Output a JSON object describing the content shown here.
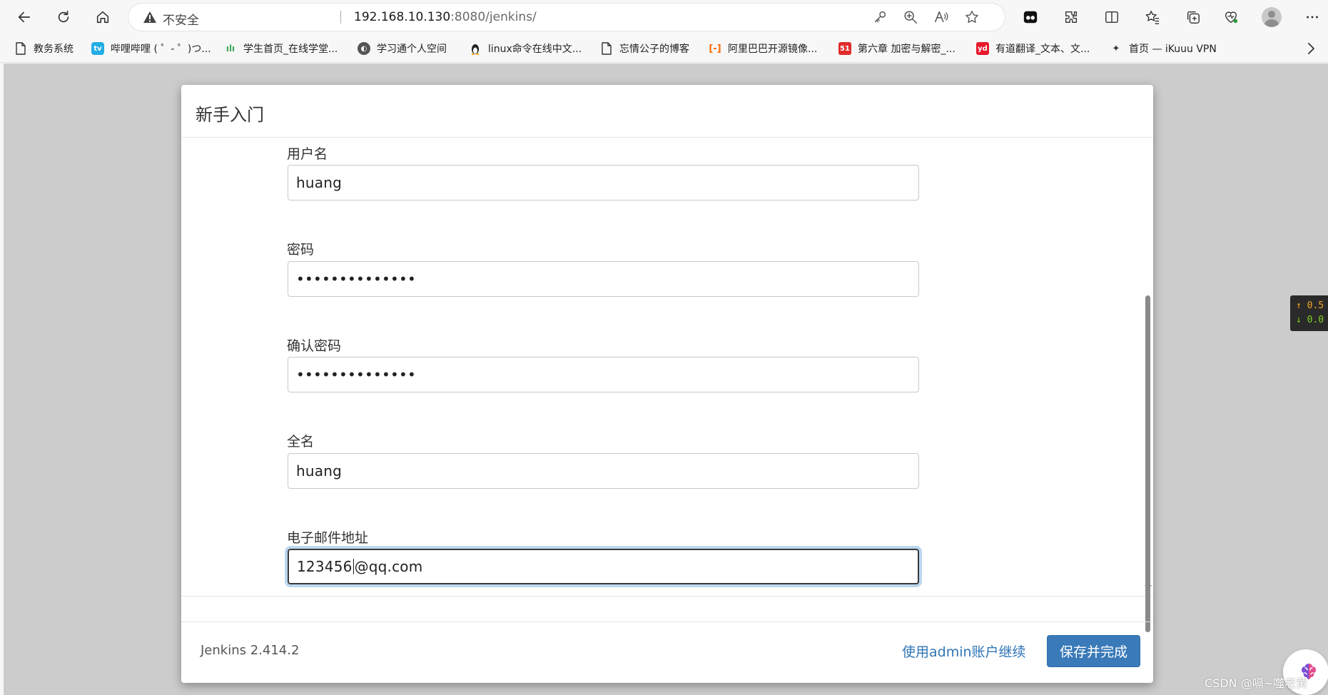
{
  "browser": {
    "security_label": "不安全",
    "url_host": "192.168.10.130",
    "url_rest": ":8080/jenkins/"
  },
  "bookmarks": [
    {
      "label": "教务系统",
      "icon": "page-icon"
    },
    {
      "label": "哔哩哔哩 ( ゜- ゜)つ...",
      "icon": "bilibili-icon"
    },
    {
      "label": "学生首页_在线学堂...",
      "icon": "xuetang-icon"
    },
    {
      "label": "学习通个人空间",
      "icon": "chaoxing-icon"
    },
    {
      "label": "linux命令在线中文...",
      "icon": "linux-penguin-icon"
    },
    {
      "label": "忘情公子的博客",
      "icon": "page-icon"
    },
    {
      "label": "阿里巴巴开源镜像...",
      "icon": "aliyun-icon"
    },
    {
      "label": "第六章 加密与解密_...",
      "icon": "51cto-icon"
    },
    {
      "label": "有道翻译_文本、文...",
      "icon": "youdao-icon"
    },
    {
      "label": "首页 — iKuuu VPN",
      "icon": "ikuuu-icon"
    }
  ],
  "dialog": {
    "title": "新手入门",
    "fields": {
      "username": {
        "label": "用户名",
        "value": "huang"
      },
      "password": {
        "label": "密码",
        "value": "••••••••••••••"
      },
      "confirm_password": {
        "label": "确认密码",
        "value": "••••••••••••••"
      },
      "fullname": {
        "label": "全名",
        "value": "huang"
      },
      "email": {
        "label": "电子邮件地址",
        "value_before_caret": "123456",
        "value_after_caret": "@qq.com"
      }
    },
    "footer": {
      "version": "Jenkins 2.414.2",
      "admin_link": "使用admin账户继续",
      "save_button": "保存并完成"
    }
  },
  "net_widget": {
    "up": "↑ 0.5",
    "down": "↓ 0.0"
  },
  "watermark": "CSDN @嗝~噬老黄",
  "colors": {
    "accent": "#3a7ab8",
    "link": "#2f75b6",
    "focus_ring": "#bcd7ef"
  }
}
